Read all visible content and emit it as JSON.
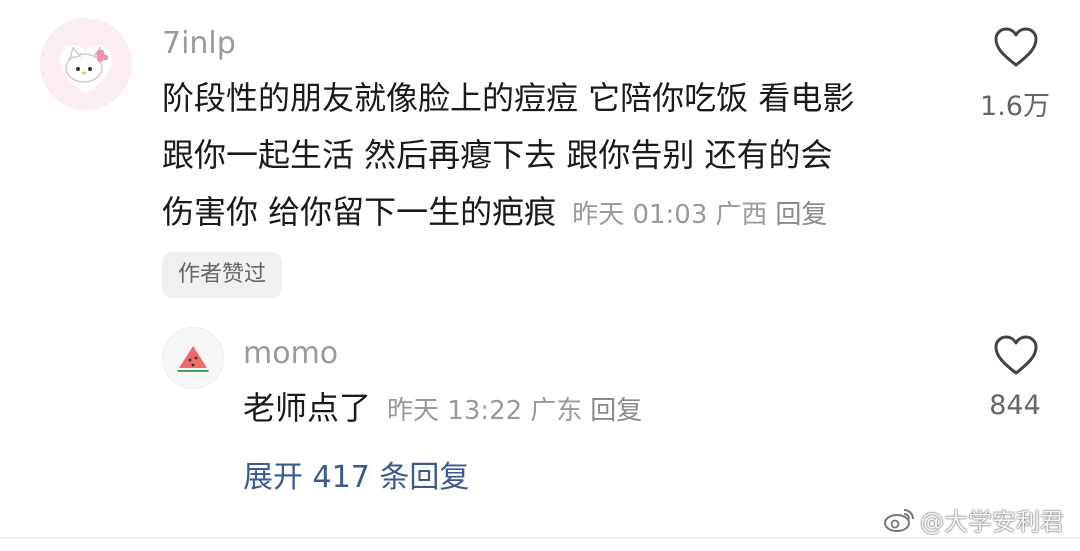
{
  "comment": {
    "username": "7inlp",
    "lines": [
      "阶段性的朋友就像脸上的痘痘 它陪你吃饭 看电影",
      "跟你一起生活 然后再瘪下去 跟你告别 还有的会",
      "伤害你 给你留下一生的疤痕"
    ],
    "time": "昨天 01:03",
    "location": "广西",
    "reply_label": "回复",
    "likes": "1.6万",
    "author_liked_tag": "作者赞过"
  },
  "reply": {
    "username": "momo",
    "text": "老师点了",
    "time": "昨天 13:22",
    "location": "广东",
    "reply_label": "回复",
    "likes": "844"
  },
  "expand_label": "展开 417 条回复",
  "watermark": "@大学安利君",
  "colors": {
    "meta_gray": "#9a9a9a",
    "link_blue": "#3b5b8f",
    "avatar_pink": "#fbeef2",
    "tag_bg": "#f0f0f0"
  },
  "icons": [
    "hello-kitty-avatar",
    "watermelon-avatar",
    "heart-outline-icon",
    "weibo-icon"
  ]
}
